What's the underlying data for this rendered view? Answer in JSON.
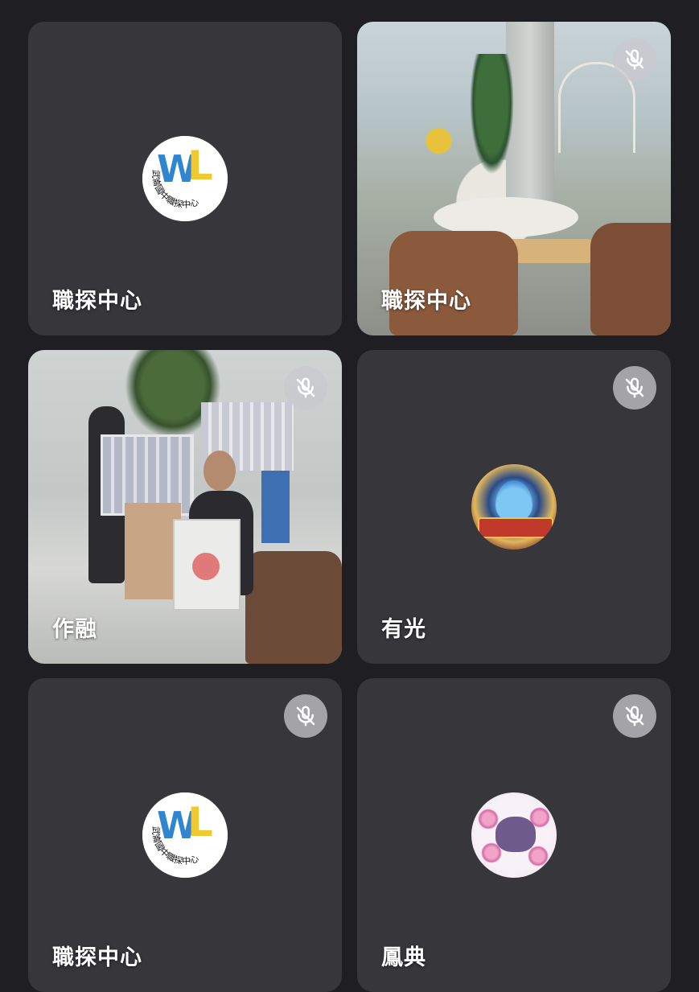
{
  "participants": [
    {
      "name": "職探中心",
      "avatar": "wl-logo",
      "muted": false,
      "video": false
    },
    {
      "name": "職探中心",
      "avatar": "camera",
      "muted": true,
      "video": true
    },
    {
      "name": "作融",
      "avatar": "camera",
      "muted": true,
      "video": true
    },
    {
      "name": "有光",
      "avatar": "dragon-quest-monsters-avatar",
      "muted": true,
      "video": false
    },
    {
      "name": "職探中心",
      "avatar": "wl-logo",
      "muted": true,
      "video": false
    },
    {
      "name": "鳳典",
      "avatar": "cat-avatar",
      "muted": true,
      "video": false
    }
  ],
  "logo": {
    "ring_text": "武崙國中職探中心"
  },
  "icons": {
    "mute": "mic-off-icon"
  },
  "colors": {
    "background": "#1f1f23",
    "tile": "#36363b",
    "mute_bg": "#c8c8cd"
  }
}
